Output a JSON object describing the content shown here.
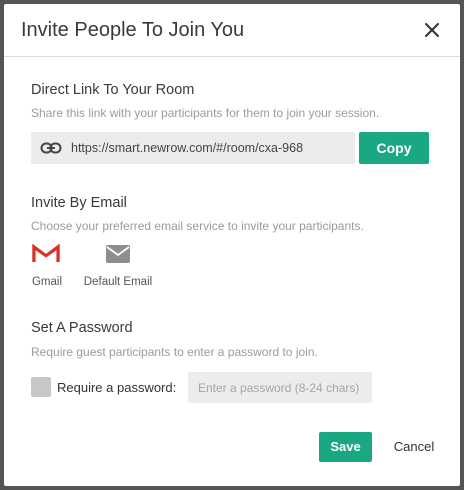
{
  "dialog": {
    "title": "Invite People To Join You",
    "close_icon": "close-icon"
  },
  "direct_link": {
    "title": "Direct Link To Your Room",
    "description": "Share this link with your participants for them to join your session.",
    "url": "https://smart.newrow.com/#/room/cxa-968",
    "link_icon": "link-icon",
    "copy_label": "Copy"
  },
  "invite_email": {
    "title": "Invite By Email",
    "description": "Choose your preferred email service to invite your participants.",
    "options": [
      {
        "label": "Gmail",
        "icon": "gmail-icon"
      },
      {
        "label": "Default Email",
        "icon": "envelope-icon"
      }
    ]
  },
  "password": {
    "title": "Set A Password",
    "description": "Require guest participants to enter a password to join.",
    "checkbox_label": "Require a password:",
    "checked": false,
    "input_placeholder": "Enter a password (8-24 chars)",
    "input_value": ""
  },
  "footer": {
    "save_label": "Save",
    "cancel_label": "Cancel"
  },
  "colors": {
    "accent": "#1aa784",
    "overlay": "#555555",
    "field_bg": "#ececec"
  }
}
